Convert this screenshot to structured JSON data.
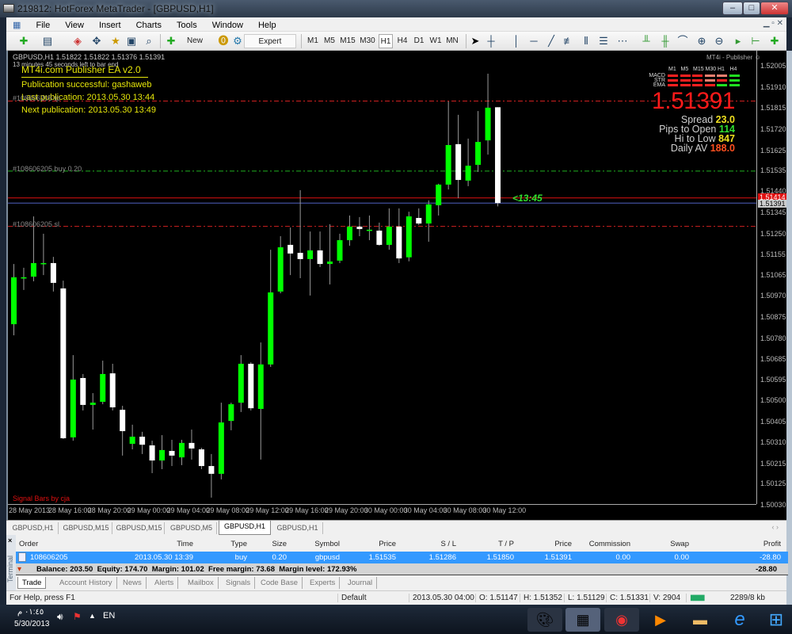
{
  "window": {
    "title": "219812: HotForex MetaTrader - [GBPUSD,H1]"
  },
  "menu": [
    "File",
    "View",
    "Insert",
    "Charts",
    "Tools",
    "Window",
    "Help"
  ],
  "toolbar": {
    "new_order": "New Order",
    "expert_advisors": "Expert Advisors",
    "timeframes": [
      "M1",
      "M5",
      "M15",
      "M30",
      "H1",
      "H4",
      "D1",
      "W1",
      "MN"
    ],
    "active_timeframe": "H1"
  },
  "chart": {
    "header": "GBPUSD,H1  1.51822 1.51822 1.51376 1.51391",
    "countdown": "13 minutes 45 seconds left to bar end",
    "ea": {
      "title": "MT4i.com Publisher EA v2.0",
      "status": "Publication successful: gashaweb",
      "last": "Last publication: 2013.05.30 13:44",
      "next": "Next publication: 2013.05.30 13:49"
    },
    "publisher_label": "MT4i - Publisher",
    "signal_bars_label": "Signal Bars by cja",
    "bar_timer": "<13:45",
    "order_labels": {
      "tp": "#108606205 tp",
      "open": "#108606205 buy 0.20",
      "sl": "#108606205 sl"
    },
    "levels": {
      "tp": 1.5185,
      "open": 1.51535,
      "ask": 1.51414,
      "bid": 1.51391,
      "sl": 1.51286
    },
    "ask_label": "1.51414",
    "bid_label": "1.51391",
    "signals": {
      "timeframes": [
        "M1",
        "M5",
        "M15",
        "M30",
        "H1",
        "H4"
      ],
      "rows": [
        "MACD",
        "STR",
        "EMA"
      ],
      "states": [
        [
          "down",
          "down",
          "down",
          "weak",
          "weak",
          "up"
        ],
        [
          "down",
          "down",
          "down",
          "weak",
          "down",
          "up"
        ],
        [
          "down",
          "down",
          "down",
          "down",
          "up",
          "up"
        ]
      ]
    },
    "colors": {
      "down": "#ff2020",
      "weak": "#f08070",
      "up": "#20e020",
      "bull": "#00ff00",
      "bear": "#ffffff"
    },
    "big_price": "1.51391",
    "stats": [
      {
        "label": "Spread",
        "value": "23.0",
        "color": "#f0e020"
      },
      {
        "label": "Pips to Open",
        "value": "114",
        "color": "#30e030"
      },
      {
        "label": "Hi to Low",
        "value": "847",
        "color": "#f0e020"
      },
      {
        "label": "Daily AV",
        "value": "188.0",
        "color": "#ff5020"
      }
    ],
    "price_ticks": [
      "1.52005",
      "1.51910",
      "1.51815",
      "1.51720",
      "1.51625",
      "1.51535",
      "1.51440",
      "1.51345",
      "1.51250",
      "1.51155",
      "1.51065",
      "1.50970",
      "1.50875",
      "1.50780",
      "1.50685",
      "1.50595",
      "1.50500",
      "1.50405",
      "1.50310",
      "1.50215",
      "1.50125",
      "1.50030"
    ],
    "time_labels": [
      {
        "label": "28 May 2013",
        "bar": 0
      },
      {
        "label": "28 May 16:00",
        "bar": 4
      },
      {
        "label": "28 May 20:00",
        "bar": 8
      },
      {
        "label": "29 May 00:00",
        "bar": 12
      },
      {
        "label": "29 May 04:00",
        "bar": 16
      },
      {
        "label": "29 May 08:00",
        "bar": 20
      },
      {
        "label": "29 May 12:00",
        "bar": 24
      },
      {
        "label": "29 May 16:00",
        "bar": 28
      },
      {
        "label": "29 May 20:00",
        "bar": 32
      },
      {
        "label": "30 May 00:00",
        "bar": 36
      },
      {
        "label": "30 May 04:00",
        "bar": 40
      },
      {
        "label": "30 May 08:00",
        "bar": 44
      },
      {
        "label": "30 May 12:00",
        "bar": 48
      }
    ],
    "ylim": [
      1.5003,
      1.52005
    ],
    "ohlc": [
      [
        1.50846,
        1.51117,
        1.50796,
        1.51057
      ],
      [
        1.51057,
        1.511,
        1.51,
        1.51057
      ],
      [
        1.5106,
        1.51331,
        1.51039,
        1.51121
      ],
      [
        1.51121,
        1.51253,
        1.51067,
        1.51121
      ],
      [
        1.51121,
        1.51149,
        1.50993,
        1.51032
      ],
      [
        1.51007,
        1.51042,
        1.5033,
        1.50333
      ],
      [
        1.50337,
        1.50707,
        1.50322,
        1.50597
      ],
      [
        1.50604,
        1.50622,
        1.50458,
        1.50483
      ],
      [
        1.50483,
        1.50536,
        1.50372,
        1.50493
      ],
      [
        1.50497,
        1.50682,
        1.50486,
        1.50622
      ],
      [
        1.50625,
        1.50668,
        1.50458,
        1.50472
      ],
      [
        1.50461,
        1.50479,
        1.50255,
        1.50365
      ],
      [
        1.50308,
        1.50394,
        1.50283,
        1.5034
      ],
      [
        1.5034,
        1.50362,
        1.50262,
        1.50304
      ],
      [
        1.50301,
        1.50322,
        1.50176,
        1.50233
      ],
      [
        1.50233,
        1.50347,
        1.50194,
        1.5028
      ],
      [
        1.50276,
        1.50326,
        1.50208,
        1.50255
      ],
      [
        1.50247,
        1.50326,
        1.50212,
        1.50312
      ],
      [
        1.50312,
        1.50372,
        1.50237,
        1.50287
      ],
      [
        1.50283,
        1.5029,
        1.50194,
        1.50208
      ],
      [
        1.50208,
        1.50262,
        1.50066,
        1.50173
      ],
      [
        1.50173,
        1.50493,
        1.50148,
        1.50404
      ],
      [
        1.50411,
        1.50493,
        1.50369,
        1.50486
      ],
      [
        1.50493,
        1.50707,
        1.50451,
        1.50668
      ],
      [
        1.50668,
        1.50675,
        1.50458,
        1.50468
      ],
      [
        1.50465,
        1.50764,
        1.50237,
        1.50665
      ],
      [
        1.50665,
        1.51181,
        1.50654,
        1.50989
      ],
      [
        1.50993,
        1.51242,
        1.50985,
        1.51192
      ],
      [
        1.51203,
        1.51281,
        1.51067,
        1.51164
      ],
      [
        1.51167,
        1.51449,
        1.51053,
        1.51139
      ],
      [
        1.51139,
        1.51263,
        1.50975,
        1.51178
      ],
      [
        1.51178,
        1.51263,
        1.51103,
        1.51117
      ],
      [
        1.51117,
        1.51296,
        1.51025,
        1.51128
      ],
      [
        1.51132,
        1.51253,
        1.51121,
        1.51224
      ],
      [
        1.51224,
        1.51335,
        1.51199,
        1.51285
      ],
      [
        1.51285,
        1.51328,
        1.51242,
        1.51274
      ],
      [
        1.51271,
        1.51335,
        1.51224,
        1.51271
      ],
      [
        1.51267,
        1.51303,
        1.51199,
        1.51203
      ],
      [
        1.51203,
        1.51367,
        1.51181,
        1.51285
      ],
      [
        1.51285,
        1.51367,
        1.51121,
        1.51142
      ],
      [
        1.51147,
        1.51352,
        1.51129,
        1.51331
      ],
      [
        1.51324,
        1.51367,
        1.51292,
        1.51299
      ],
      [
        1.51299,
        1.51403,
        1.51217,
        1.51385
      ],
      [
        1.51381,
        1.51478,
        1.51335,
        1.51474
      ],
      [
        1.51474,
        1.51848,
        1.51452,
        1.51652
      ],
      [
        1.51656,
        1.51788,
        1.51413,
        1.51495
      ],
      [
        1.51492,
        1.51681,
        1.51467,
        1.51559
      ],
      [
        1.51563,
        1.51805,
        1.51531,
        1.51666
      ],
      [
        1.51673,
        1.51973,
        1.51609,
        1.5182
      ],
      [
        1.51822,
        1.51822,
        1.51376,
        1.51391
      ]
    ]
  },
  "chart_tabs": [
    "GBPUSD,H1",
    "GBPUSD,M15",
    "GBPUSD,M15",
    "GBPUSD,M5",
    "GBPUSD,H1",
    "GBPUSD,H1"
  ],
  "active_chart_tab": 4,
  "terminal": {
    "label": "Terminal",
    "columns": [
      "Order",
      "Time",
      "Type",
      "Size",
      "Symbol",
      "Price",
      "S / L",
      "T / P",
      "Price",
      "Commission",
      "Swap",
      "Profit"
    ],
    "row": [
      "108606205",
      "2013.05.30 13:39",
      "buy",
      "0.20",
      "gbpusd",
      "1.51535",
      "1.51286",
      "1.51850",
      "1.51391",
      "0.00",
      "0.00",
      "-28.80"
    ],
    "balance": "Balance: 203.50  Equity: 174.70  Margin: 101.02  Free margin: 73.68  Margin level: 172.93%",
    "total_profit": "-28.80",
    "tabs": [
      "Trade",
      "Account History",
      "News",
      "Alerts",
      "Mailbox",
      "Signals",
      "Code Base",
      "Experts",
      "Journal"
    ]
  },
  "status": {
    "help": "For Help, press F1",
    "profile": "Default",
    "time": "2013.05.30 04:00",
    "open": "O: 1.51147",
    "high": "H: 1.51352",
    "low": "L: 1.51129",
    "close": "C: 1.51331",
    "volume": "V: 2904",
    "traffic": "2289/8 kb"
  },
  "taskbar": {
    "clock": "٠١:٤٥ م",
    "date": "5/30/2013",
    "lang": "EN"
  }
}
